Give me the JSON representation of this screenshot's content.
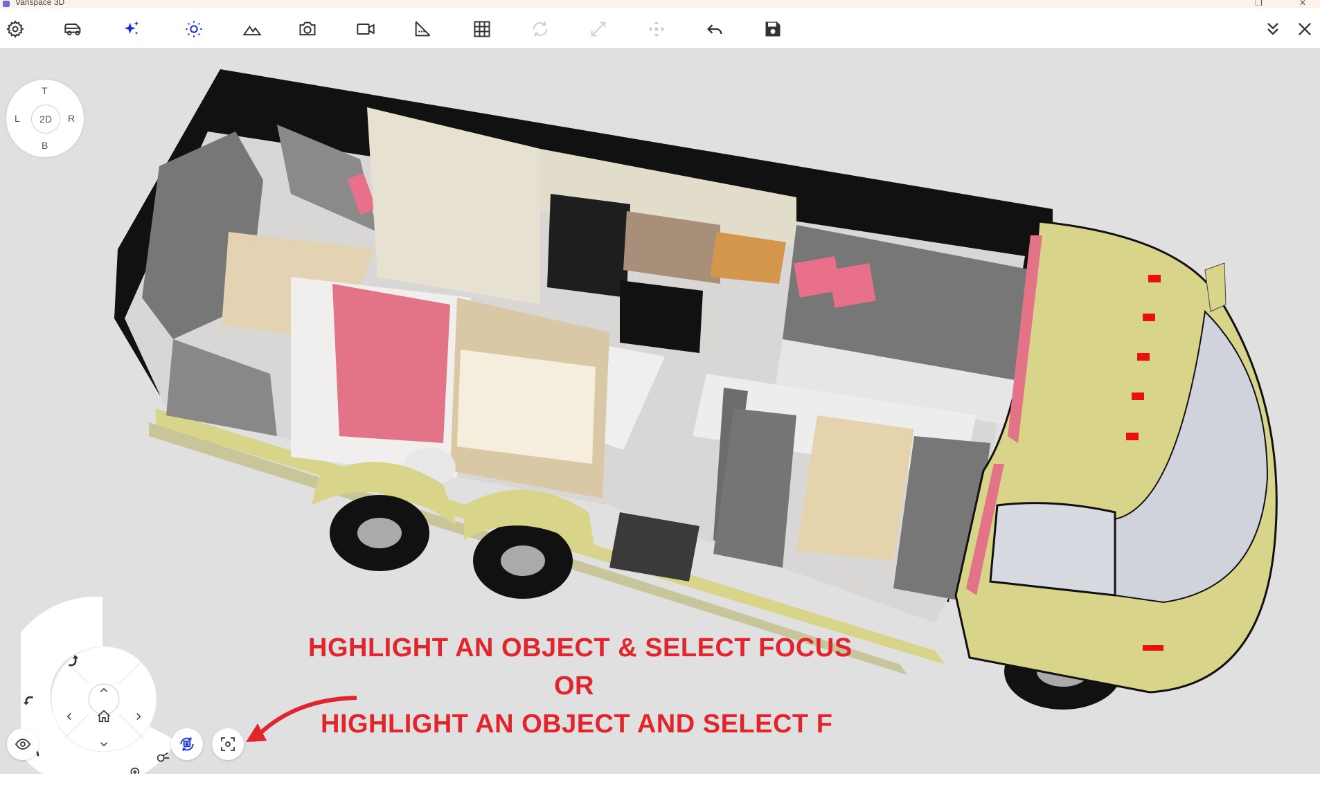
{
  "window": {
    "title": "Vanspace 3D"
  },
  "toolbar": {
    "items": [
      {
        "icon": "gear-icon"
      },
      {
        "icon": "van-icon"
      },
      {
        "icon": "sparkle-icon"
      },
      {
        "icon": "sun-icon"
      },
      {
        "icon": "mountain-icon"
      },
      {
        "icon": "camera-icon"
      },
      {
        "icon": "video-icon"
      },
      {
        "icon": "ruler-angle-icon"
      },
      {
        "icon": "grid-icon"
      },
      {
        "icon": "rotate-icon",
        "disabled": true
      },
      {
        "icon": "resize-icon",
        "disabled": true
      },
      {
        "icon": "move-icon",
        "disabled": true
      },
      {
        "icon": "undo-icon"
      },
      {
        "icon": "save-icon"
      }
    ],
    "accent_color": "#1a2be0"
  },
  "view_cube": {
    "top": "T",
    "left": "L",
    "right": "R",
    "bottom": "B",
    "center": "2D"
  },
  "annotation": {
    "line1": "HGHLIGHT AN OBJECT & SELECT FOCUS",
    "line2": "OR",
    "line3": "HIGHLIGHT AN OBJECT AND SELECT F",
    "color": "#e0252c"
  }
}
